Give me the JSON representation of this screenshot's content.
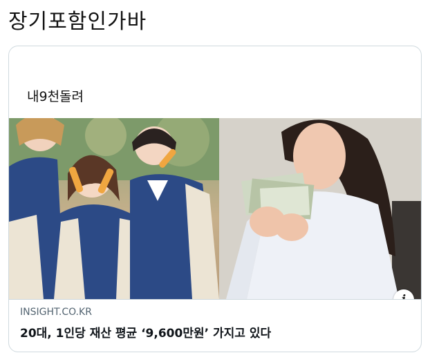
{
  "post": {
    "title": "장기포함인가바"
  },
  "card": {
    "text": "내9천돌려",
    "domain": "INSIGHT.CO.KR",
    "headline": "20대, 1인당 재산 평균 ‘9,600만원’ 가지고 있다",
    "info_icon": "i"
  },
  "colors": {
    "border": "#cfd9de",
    "domain_text": "#536471",
    "jacket_navy": "#2c4a86",
    "sleeve_cream": "#ece4d4"
  }
}
